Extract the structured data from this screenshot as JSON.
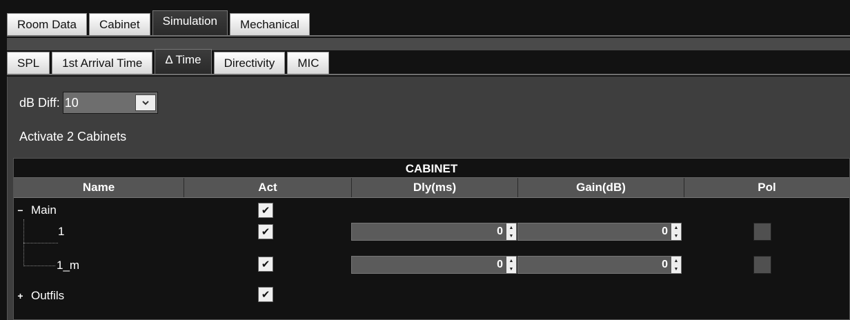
{
  "top_tabs": [
    {
      "label": "Room Data",
      "active": false
    },
    {
      "label": "Cabinet",
      "active": false
    },
    {
      "label": "Simulation",
      "active": true
    },
    {
      "label": "Mechanical",
      "active": false
    }
  ],
  "sub_tabs": [
    {
      "label": "SPL",
      "active": false
    },
    {
      "label": "1st Arrival Time",
      "active": false
    },
    {
      "label": "Δ Time",
      "active": true
    },
    {
      "label": "Directivity",
      "active": false
    },
    {
      "label": "MIC",
      "active": false
    }
  ],
  "db_diff": {
    "label": "dB Diff:",
    "value": "10"
  },
  "activate_text": "Activate 2 Cabinets",
  "table": {
    "caption": "CABINET",
    "headers": {
      "name": "Name",
      "act": "Act",
      "dly": "Dly(ms)",
      "gain": "Gain(dB)",
      "pol": "Pol"
    },
    "rows": [
      {
        "name": "Main",
        "expander": "−",
        "dly": "",
        "gain": ""
      },
      {
        "name": "1",
        "expander": "",
        "dly": "0",
        "gain": "0"
      },
      {
        "name": "1_m",
        "expander": "",
        "dly": "0",
        "gain": "0"
      },
      {
        "name": "Outfils",
        "expander": "+",
        "dly": "",
        "gain": ""
      }
    ]
  },
  "colors": {
    "background": "#121212",
    "panel": "#3e3e3e",
    "header": "#555555"
  }
}
